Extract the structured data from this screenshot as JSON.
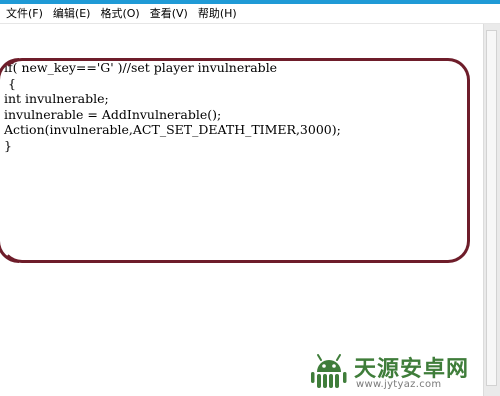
{
  "menubar": {
    "items": [
      "文件(F)",
      "编辑(E)",
      "格式(O)",
      "查看(V)",
      "帮助(H)"
    ]
  },
  "editor": {
    "lines": [
      "if( new_key=='G' )//set player invulnerable",
      " {",
      "int invulnerable;",
      "invulnerable = AddInvulnerable();",
      "Action(invulnerable,ACT_SET_DEATH_TIMER,3000);",
      "}"
    ]
  },
  "annotation": {
    "color": "#6e1d2a"
  },
  "watermark": {
    "title": "天源安卓网",
    "url": "www.jytyaz.com",
    "icon": "android-robot-icon",
    "color": "#3f7d3a"
  }
}
